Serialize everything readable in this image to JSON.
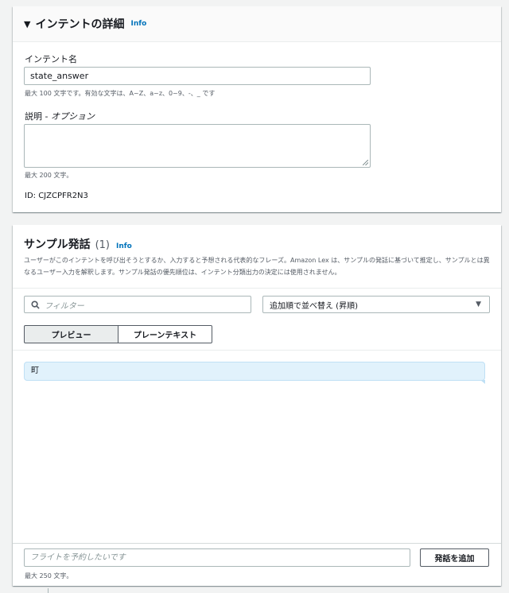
{
  "intent_panel": {
    "caret": "▼",
    "title": "インテントの詳細",
    "info": "Info",
    "name_label": "インテント名",
    "name_value": "state_answer",
    "name_hint": "最大 100 文字です。有効な文字は、A~Z、a~z、0~9、-、_ です",
    "desc_label": "説明 - ",
    "desc_label_optional": "オプション",
    "desc_value": "",
    "desc_hint": "最大 200 文字。",
    "id_text": "ID: CJZCPFR2N3"
  },
  "utterances_panel": {
    "title": "サンプル発話",
    "count": "(1)",
    "info": "Info",
    "description": "ユーザーがこのインテントを呼び出そうとするか、入力すると予想される代表的なフレーズ。Amazon Lex は、サンプルの発話に基づいて推定し、サンプルとは異なるユーザー入力を解釈します。サンプル発話の優先順位は、インテント分類出力の決定には使用されません。",
    "filter_placeholder": "フィルター",
    "sort_value": "追加順で並べ替え (昇順)",
    "tabs": [
      {
        "label": "プレビュー",
        "active": true
      },
      {
        "label": "プレーンテキスト",
        "active": false
      }
    ],
    "items": [
      "町"
    ],
    "new_placeholder": "フライトを予約したいです",
    "add_button": "発話を追加",
    "max_hint": "最大 250 文字。"
  },
  "icons": {
    "filter": "search-icon",
    "sort": "caret-down-icon",
    "section_toggle": "caret-down-icon"
  },
  "colors": {
    "background": "#f2f3f3",
    "link": "#0073bb",
    "utterance_bubble": "#e1f2fc",
    "border": "#aab7b8"
  }
}
